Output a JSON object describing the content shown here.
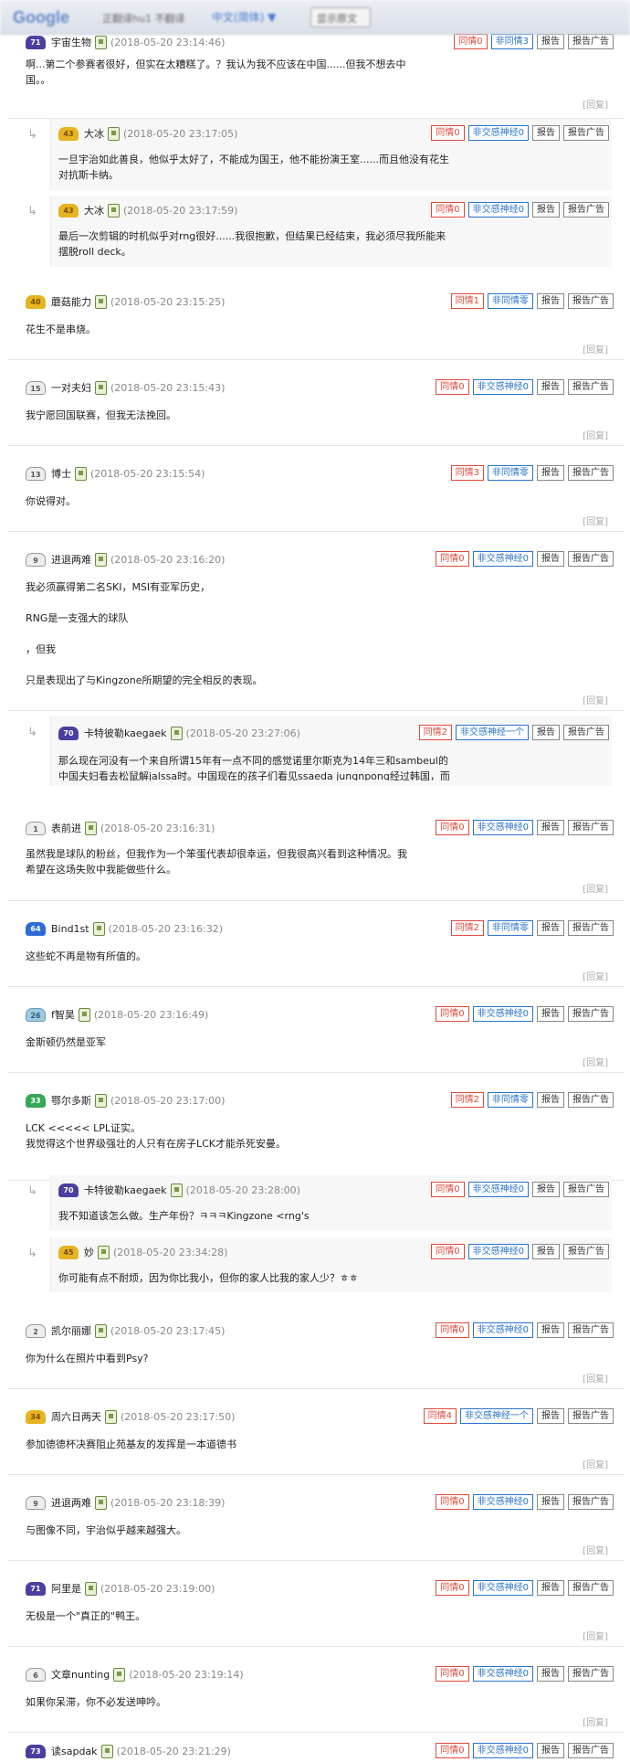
{
  "translate_bar": {
    "logo": "Google",
    "label": "正翻译hu1 不翻译",
    "select": "中文(简体) ▼",
    "button": "显示原文"
  },
  "actions": {
    "report": "报告",
    "report_ad": "报告广告",
    "reply": "[回复]"
  },
  "comments": [
    {
      "id": "c0",
      "level": "71",
      "badge": "purple",
      "user": "宇宙生物",
      "time": "(2018-05-20 23:14:46)",
      "agree": "同情0",
      "disagree": "非同情3",
      "lines": [
        "啊...第二个参赛者很好，但实在太糟糕了。？我认为我不应该在中国......但我不想去中",
        "国。。"
      ]
    },
    {
      "id": "r0",
      "reply": true,
      "level": "43",
      "badge": "yellow",
      "user": "大冰",
      "time": "(2018-05-20 23:17:05)",
      "agree": "同情0",
      "disagree": "非交感神经0",
      "lines": [
        "一旦宇治如此善良，他似乎太好了，不能成为国王，他不能扮演王室......而且他没有花生",
        "对抗斯卡纳。"
      ]
    },
    {
      "id": "r1",
      "reply": true,
      "level": "43",
      "badge": "yellow",
      "user": "大冰",
      "time": "(2018-05-20 23:17:59)",
      "agree": "同情0",
      "disagree": "非交感神经0",
      "lines": [
        "最后一次剪辑的时机似乎对rng很好......我很抱歉，但结果已经结束，我必须尽我所能来",
        "摆脱roll deck。"
      ]
    },
    {
      "id": "c1",
      "level": "40",
      "badge": "yellow",
      "user": "蘑菇能力",
      "time": "(2018-05-20 23:15:25)",
      "agree": "同情1",
      "disagree": "非同情零",
      "lines": [
        "花生不是串烧。"
      ]
    },
    {
      "id": "c2",
      "level": "15",
      "badge": "gray",
      "user": "一对夫妇",
      "time": "(2018-05-20 23:15:43)",
      "agree": "同情0",
      "disagree": "非交感神经0",
      "lines": [
        "我宁愿回国联赛，但我无法挽回。"
      ]
    },
    {
      "id": "c3",
      "level": "13",
      "badge": "gray",
      "user": "博士",
      "time": "(2018-05-20 23:15:54)",
      "agree": "同情3",
      "disagree": "非同情零",
      "lines": [
        "你说得对。"
      ]
    },
    {
      "id": "c4",
      "level": "9",
      "badge": "gray",
      "user": "进退两难",
      "time": "(2018-05-20 23:16:20)",
      "agree": "同情0",
      "disagree": "非交感神经0",
      "lines": [
        "我必须赢得第二名SKI，MSI有亚军历史，",
        "",
        "RNG是一支强大的球队",
        "",
        "，但我",
        "",
        "只是表现出了与Kingzone所期望的完全相反的表现。"
      ]
    },
    {
      "id": "r2",
      "reply": true,
      "level": "70",
      "badge": "purple",
      "user": "卡特彼勒kaegaek",
      "time": "(2018-05-20 23:27:06)",
      "agree": "同情2",
      "disagree": "非交感神经一个",
      "lines": [
        "那么现在河没有一个来自所谓15年有一点不同的感觉诺里尔斯克为14年三和sambeul的",
        "中国夫妇看去松鼠解jalssa时。中国现在的孩子们看见ssaeda jungnpong经过韩国，而"
      ]
    },
    {
      "id": "c5",
      "level": "1",
      "badge": "gray",
      "user": "表前进",
      "time": "(2018-05-20 23:16:31)",
      "agree": "同情0",
      "disagree": "非交感神经0",
      "lines": [
        "虽然我是球队的粉丝，但我作为一个笨蛋代表却很幸运，但我很高兴看到这种情况。我",
        "希望在这场失败中我能做些什么。"
      ]
    },
    {
      "id": "c6",
      "level": "64",
      "badge": "blue",
      "user": "Bind1st",
      "time": "(2018-05-20 23:16:32)",
      "agree": "同情2",
      "disagree": "非同情零",
      "lines": [
        "这些蛇不再是物有所值的。"
      ]
    },
    {
      "id": "c7",
      "level": "26",
      "badge": "teal",
      "user": "f智昊",
      "time": "(2018-05-20 23:16:49)",
      "agree": "同情0",
      "disagree": "非交感神经0",
      "lines": [
        "金斯顿仍然是亚军"
      ]
    },
    {
      "id": "c8",
      "level": "33",
      "badge": "green",
      "user": "鄂尔多斯",
      "time": "(2018-05-20 23:17:00)",
      "agree": "同情2",
      "disagree": "非同情零",
      "lines": [
        "LCK <<<<< LPL证实。",
        "我觉得这个世界级强壮的人只有在房子LCK才能杀死安曼。"
      ]
    },
    {
      "id": "r3",
      "reply": true,
      "level": "70",
      "badge": "purple",
      "user": "卡特彼勒kaegaek",
      "time": "(2018-05-20 23:28:00)",
      "agree": "同情0",
      "disagree": "非交感神经0",
      "lines": [
        "我不知道该怎么做。生产年份？ㅋㅋㅋKingzone <rng's"
      ]
    },
    {
      "id": "r4",
      "reply": true,
      "level": "45",
      "badge": "yellow",
      "user": "妙",
      "time": "(2018-05-20 23:34:28)",
      "agree": "同情0",
      "disagree": "非交感神经0",
      "lines": [
        "你可能有点不耐烦，因为你比我小，但你的家人比我的家人少？ㅎㅎ"
      ]
    },
    {
      "id": "c9",
      "level": "2",
      "badge": "gray",
      "user": "凯尔丽娜",
      "time": "(2018-05-20 23:17:45)",
      "agree": "同情0",
      "disagree": "非交感神经0",
      "lines": [
        "你为什么在照片中看到Psy?"
      ]
    },
    {
      "id": "c10",
      "level": "34",
      "badge": "yellow",
      "user": "周六日两天",
      "time": "(2018-05-20 23:17:50)",
      "agree": "同情4",
      "disagree": "非交感神经一个",
      "lines": [
        "参加德德杯决赛阻止苑基友的发挥是一本道德书"
      ]
    },
    {
      "id": "c11",
      "level": "9",
      "badge": "gray",
      "user": "进退两难",
      "time": "(2018-05-20 23:18:39)",
      "agree": "同情0",
      "disagree": "非交感神经0",
      "lines": [
        "与图像不同，宇治似乎越来越强大。"
      ]
    },
    {
      "id": "c12",
      "level": "71",
      "badge": "purple",
      "user": "阿里是",
      "time": "(2018-05-20 23:19:00)",
      "agree": "同情0",
      "disagree": "非交感神经0",
      "lines": [
        "无极是一个\"真正的\"鸭王。"
      ]
    },
    {
      "id": "c13",
      "level": "6",
      "badge": "gray",
      "user": "文章nunting",
      "time": "(2018-05-20 23:19:14)",
      "agree": "同情0",
      "disagree": "非交感神经0",
      "lines": [
        "如果你呆滞，你不必发送呻吟。"
      ]
    },
    {
      "id": "c14",
      "level": "73",
      "badge": "purple",
      "user": "读sapdak",
      "time": "(2018-05-20 23:21:29)",
      "agree": "同情0",
      "disagree": "非交感神经0",
      "lines": []
    }
  ]
}
